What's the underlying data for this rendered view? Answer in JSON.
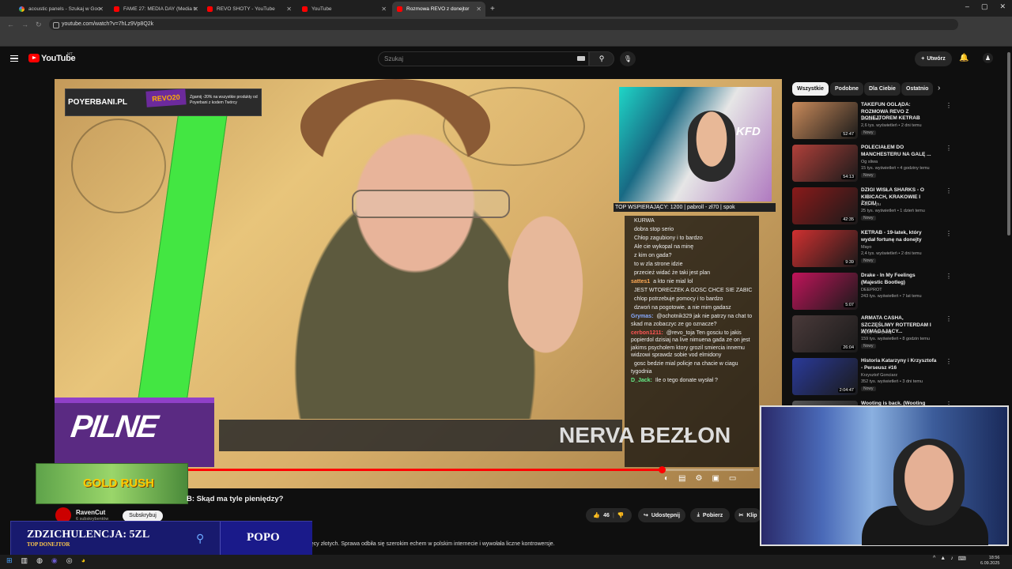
{
  "browser": {
    "tabs": [
      {
        "label": "acoustic panels - Szukaj w Goo",
        "icon": "google-icon"
      },
      {
        "label": "FAME 27: MEDIA DAY (Media tr",
        "icon": "youtube-icon"
      },
      {
        "label": "REVO SHOTY - YouTube",
        "icon": "youtube-icon"
      },
      {
        "label": "YouTube",
        "icon": "youtube-icon"
      },
      {
        "label": "Rozmowa REVO z donejtor",
        "icon": "youtube-icon"
      }
    ],
    "url": "youtube.com/watch?v=7hLz9Vp8Q2k"
  },
  "youtube": {
    "logo_text": "YouTube",
    "country": "MT",
    "search_placeholder": "Szukaj",
    "create_label": "Utwórz"
  },
  "video": {
    "ad_brand": "POYERBANI.PL",
    "ad_code": "REVO20",
    "ad_small": "Zgarnij -20% na wszystkie produkty od Poyerbani z kodem Twórcy",
    "webcam_logo": "KFD",
    "top_donors": "TOP WSPIERAJĄCY: 1200 |    pabroll - zł70 |    spok",
    "pilne": "PILNE",
    "banner": "NERVA BEZŁON",
    "game_ad": "GOLD RUSH"
  },
  "chat": [
    {
      "user": "",
      "text": "KURWA",
      "color": "#ddd"
    },
    {
      "user": "",
      "text": "dobra stop serio",
      "color": "#8a7aff"
    },
    {
      "user": "",
      "text": "Chłop zagubiony i to bardzo",
      "color": "#ff6a8a"
    },
    {
      "user": "",
      "text": "Ale cie wykopal na minę",
      "color": "#c77aff"
    },
    {
      "user": "",
      "text": "z kim on gada?",
      "color": "#ff6666"
    },
    {
      "user": "",
      "text": "to w zla strone idzie",
      "color": "#888"
    },
    {
      "user": "",
      "text": "przecież widać że taki jest plan",
      "color": "#6a8aff"
    },
    {
      "user": "sattes1",
      "text": "a kto nie mial lol",
      "color": "#ffaa55"
    },
    {
      "user": "",
      "text": "JEST WTORECZEK A GOSC CHCE SIE ZABIC",
      "color": "#bb88ff"
    },
    {
      "user": "",
      "text": "chlop potrzebuje pomocy i to bardzo",
      "color": "#66bbff"
    },
    {
      "user": "",
      "text": "dzwoń na pogotowie, a nie mim gadasz",
      "color": "#8888ff"
    },
    {
      "user": "Grymas:",
      "text": "@ochotnik329 jak nie patrzy na chat to skad ma zobaczyc ze go oznacze?",
      "color": "#88aaff"
    },
    {
      "user": "cerbon1211:",
      "text": "@revo_toja Ten gosciu to jakis popierdol dzisiaj na live nimuena gada ze on jest jakims psycholem ktory grozil smiercia innemu widzowi sprawdz sobie vod elmidony",
      "color": "#ff5555"
    },
    {
      "user": "",
      "text": "gosc bedzie mial policje na chacie w ciagu tygodnia",
      "color": "#55ccff"
    },
    {
      "user": "D_Jack:",
      "text": "Ile o tego donate wysłał ?",
      "color": "#66ee88"
    }
  ],
  "below": {
    "title": "B: Skąd ma tyle pieniędzy?",
    "channel": "RavenCut",
    "subs": "6 subskrybentów",
    "subscribe": "Subskrybuj",
    "likes": "46",
    "share": "Udostępnij",
    "download": "Pobierz",
    "clip": "Klip",
    "description": "onad 50 tysięcy złotych. Sprawa odbiła się szerokim echem w polskim internecie i wywołała liczne kontrowersje."
  },
  "donation": {
    "text": "ZDZICHULENCJA: 5ZL",
    "sub": "TOP DONEJTOR",
    "target": "POPO"
  },
  "sidebar": {
    "chips": [
      "Wszystkie",
      "Podobne",
      "Dla Ciebie",
      "Ostatnio"
    ],
    "items": [
      {
        "title": "TAKEFUN OGLĄDA: ROZMOWA REVO Z DONEJTOREM KETRAB",
        "channel": "Dostawca",
        "meta": "2,6 tys. wyświetleń • 2 dni temu",
        "duration": "52:47",
        "badge": "Nowy",
        "thumb": "#c98a5a"
      },
      {
        "title": "POLECIAŁEM DO MANCHESTERU NA GALĘ ...",
        "channel": "Og sliwa",
        "meta": "15 tys. wyświetleń • 4 godziny temu",
        "duration": "54:13",
        "badge": "Nowy",
        "thumb": "#b0403a"
      },
      {
        "title": "DZIGI WISŁA SHARKS - O KIBICACH, KRAKOWIE I ŻYCIU",
        "channel": "Fala Hejtu",
        "meta": "25 tys. wyświetleń • 1 dzień temu",
        "duration": "42:35",
        "badge": "Nowy",
        "thumb": "#8a1a1a"
      },
      {
        "title": "KETRAB - 19-latek, który wydał fortunę na donejty",
        "channel": "Mayo",
        "meta": "2,4 tys. wyświetleń • 2 dni temu",
        "duration": "9:39",
        "badge": "Nowy",
        "thumb": "#d03030"
      },
      {
        "title": "Drake - In My Feelings (Majestic Bootleg)",
        "channel": "DEEPROT",
        "meta": "243 tys. wyświetleń • 7 lat temu",
        "duration": "5:07",
        "badge": "",
        "thumb": "#c0145a"
      },
      {
        "title": "ARMATA CASHA, SZCZĘŚLIWY ROTTERDAM I WYMAGAJĄCY...",
        "channel": "Łączy nas piłka",
        "meta": "159 tys. wyświetleń • 8 godzin temu",
        "duration": "26:04",
        "badge": "Nowy",
        "thumb": "#4a3a3a"
      },
      {
        "title": "Historia Katarzyny i Krzysztofa - Perseusz #16",
        "channel": "Krzysztof Gonciarz",
        "meta": "352 tys. wyświetleń • 3 dni temu",
        "duration": "2:04:47",
        "badge": "Nowy",
        "thumb": "#2a3a9a"
      },
      {
        "title": "Wooting is back. (Wooting 80HE",
        "channel": "",
        "meta": "",
        "duration": "",
        "badge": "",
        "thumb": "#555"
      }
    ]
  },
  "taskbar": {
    "time": "18:56",
    "date": "6.09.2025"
  }
}
